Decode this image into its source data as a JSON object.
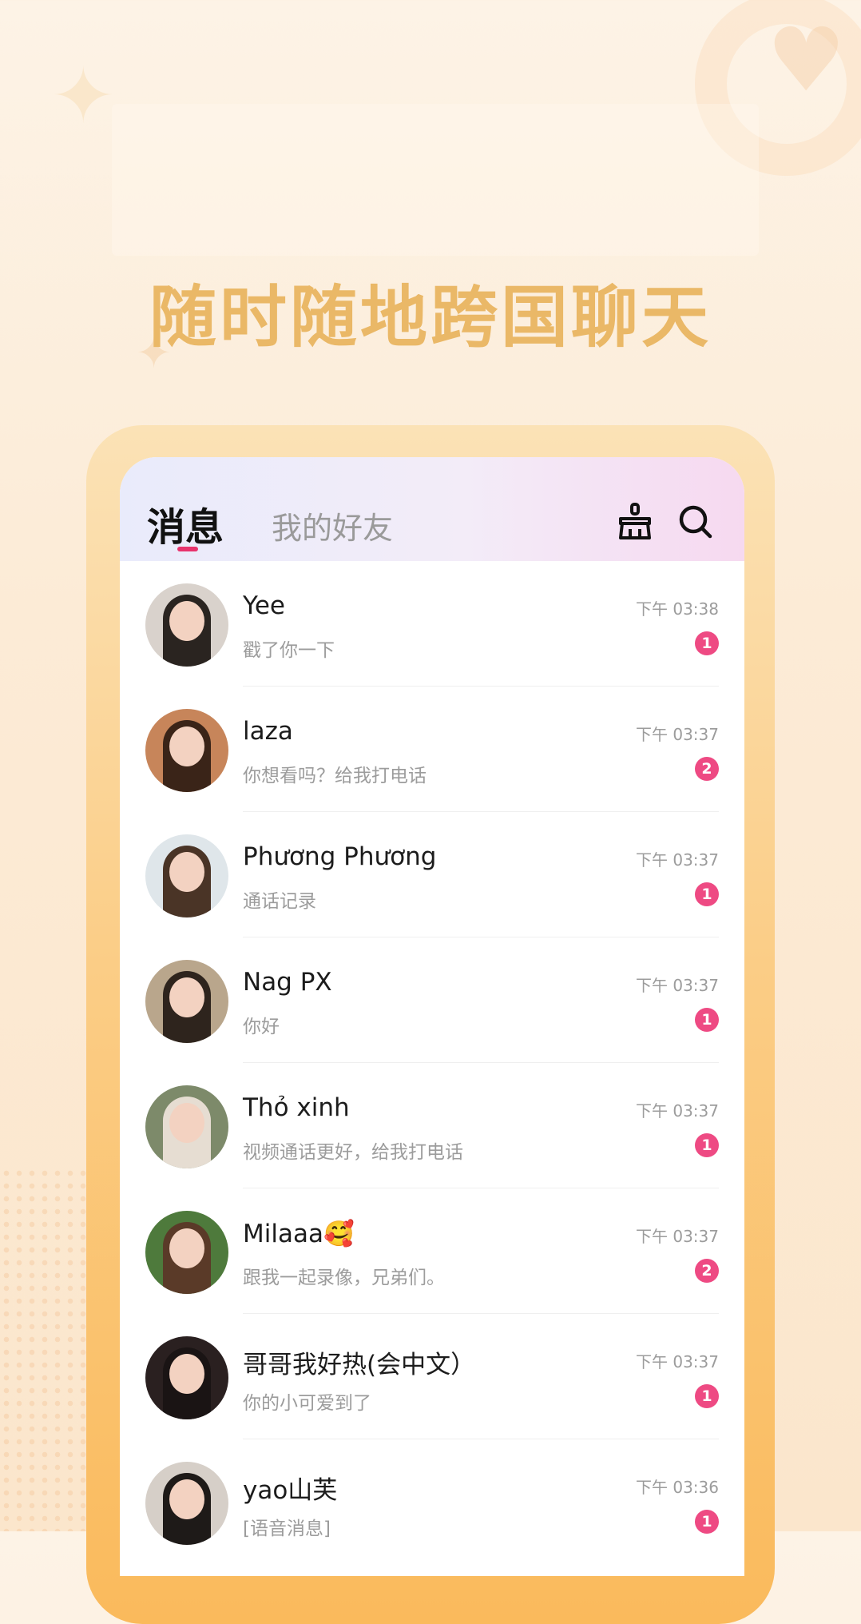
{
  "headline": "随时随地跨国聊天",
  "tabs": {
    "active": "消息",
    "inactive": "我的好友"
  },
  "colors": {
    "accent": "#e8336d",
    "badge": "#ee4a83",
    "headline": "#eab867"
  },
  "icons": {
    "clean": "broom-icon",
    "search": "search-icon"
  },
  "conversations": [
    {
      "name": "Yee",
      "time": "下午 03:38",
      "preview": "戳了你一下",
      "unread": "1"
    },
    {
      "name": "laza",
      "time": "下午 03:37",
      "preview": "你想看吗？给我打电话",
      "unread": "2"
    },
    {
      "name": "Phương Phương",
      "time": "下午 03:37",
      "preview": "通话记录",
      "unread": "1"
    },
    {
      "name": "Nag PX",
      "time": "下午 03:37",
      "preview": "你好",
      "unread": "1"
    },
    {
      "name": "Thỏ xinh",
      "time": "下午 03:37",
      "preview": "视频通话更好，给我打电话",
      "unread": "1"
    },
    {
      "name": "Milaaa🥰",
      "time": "下午 03:37",
      "preview": "跟我一起录像，兄弟们。",
      "unread": "2"
    },
    {
      "name": "哥哥我好热(会中文）",
      "time": "下午 03:37",
      "preview": "你的小可爱到了",
      "unread": "1"
    },
    {
      "name": "yao山芙",
      "time": "下午 03:36",
      "preview": "[语音消息]",
      "unread": "1"
    }
  ]
}
